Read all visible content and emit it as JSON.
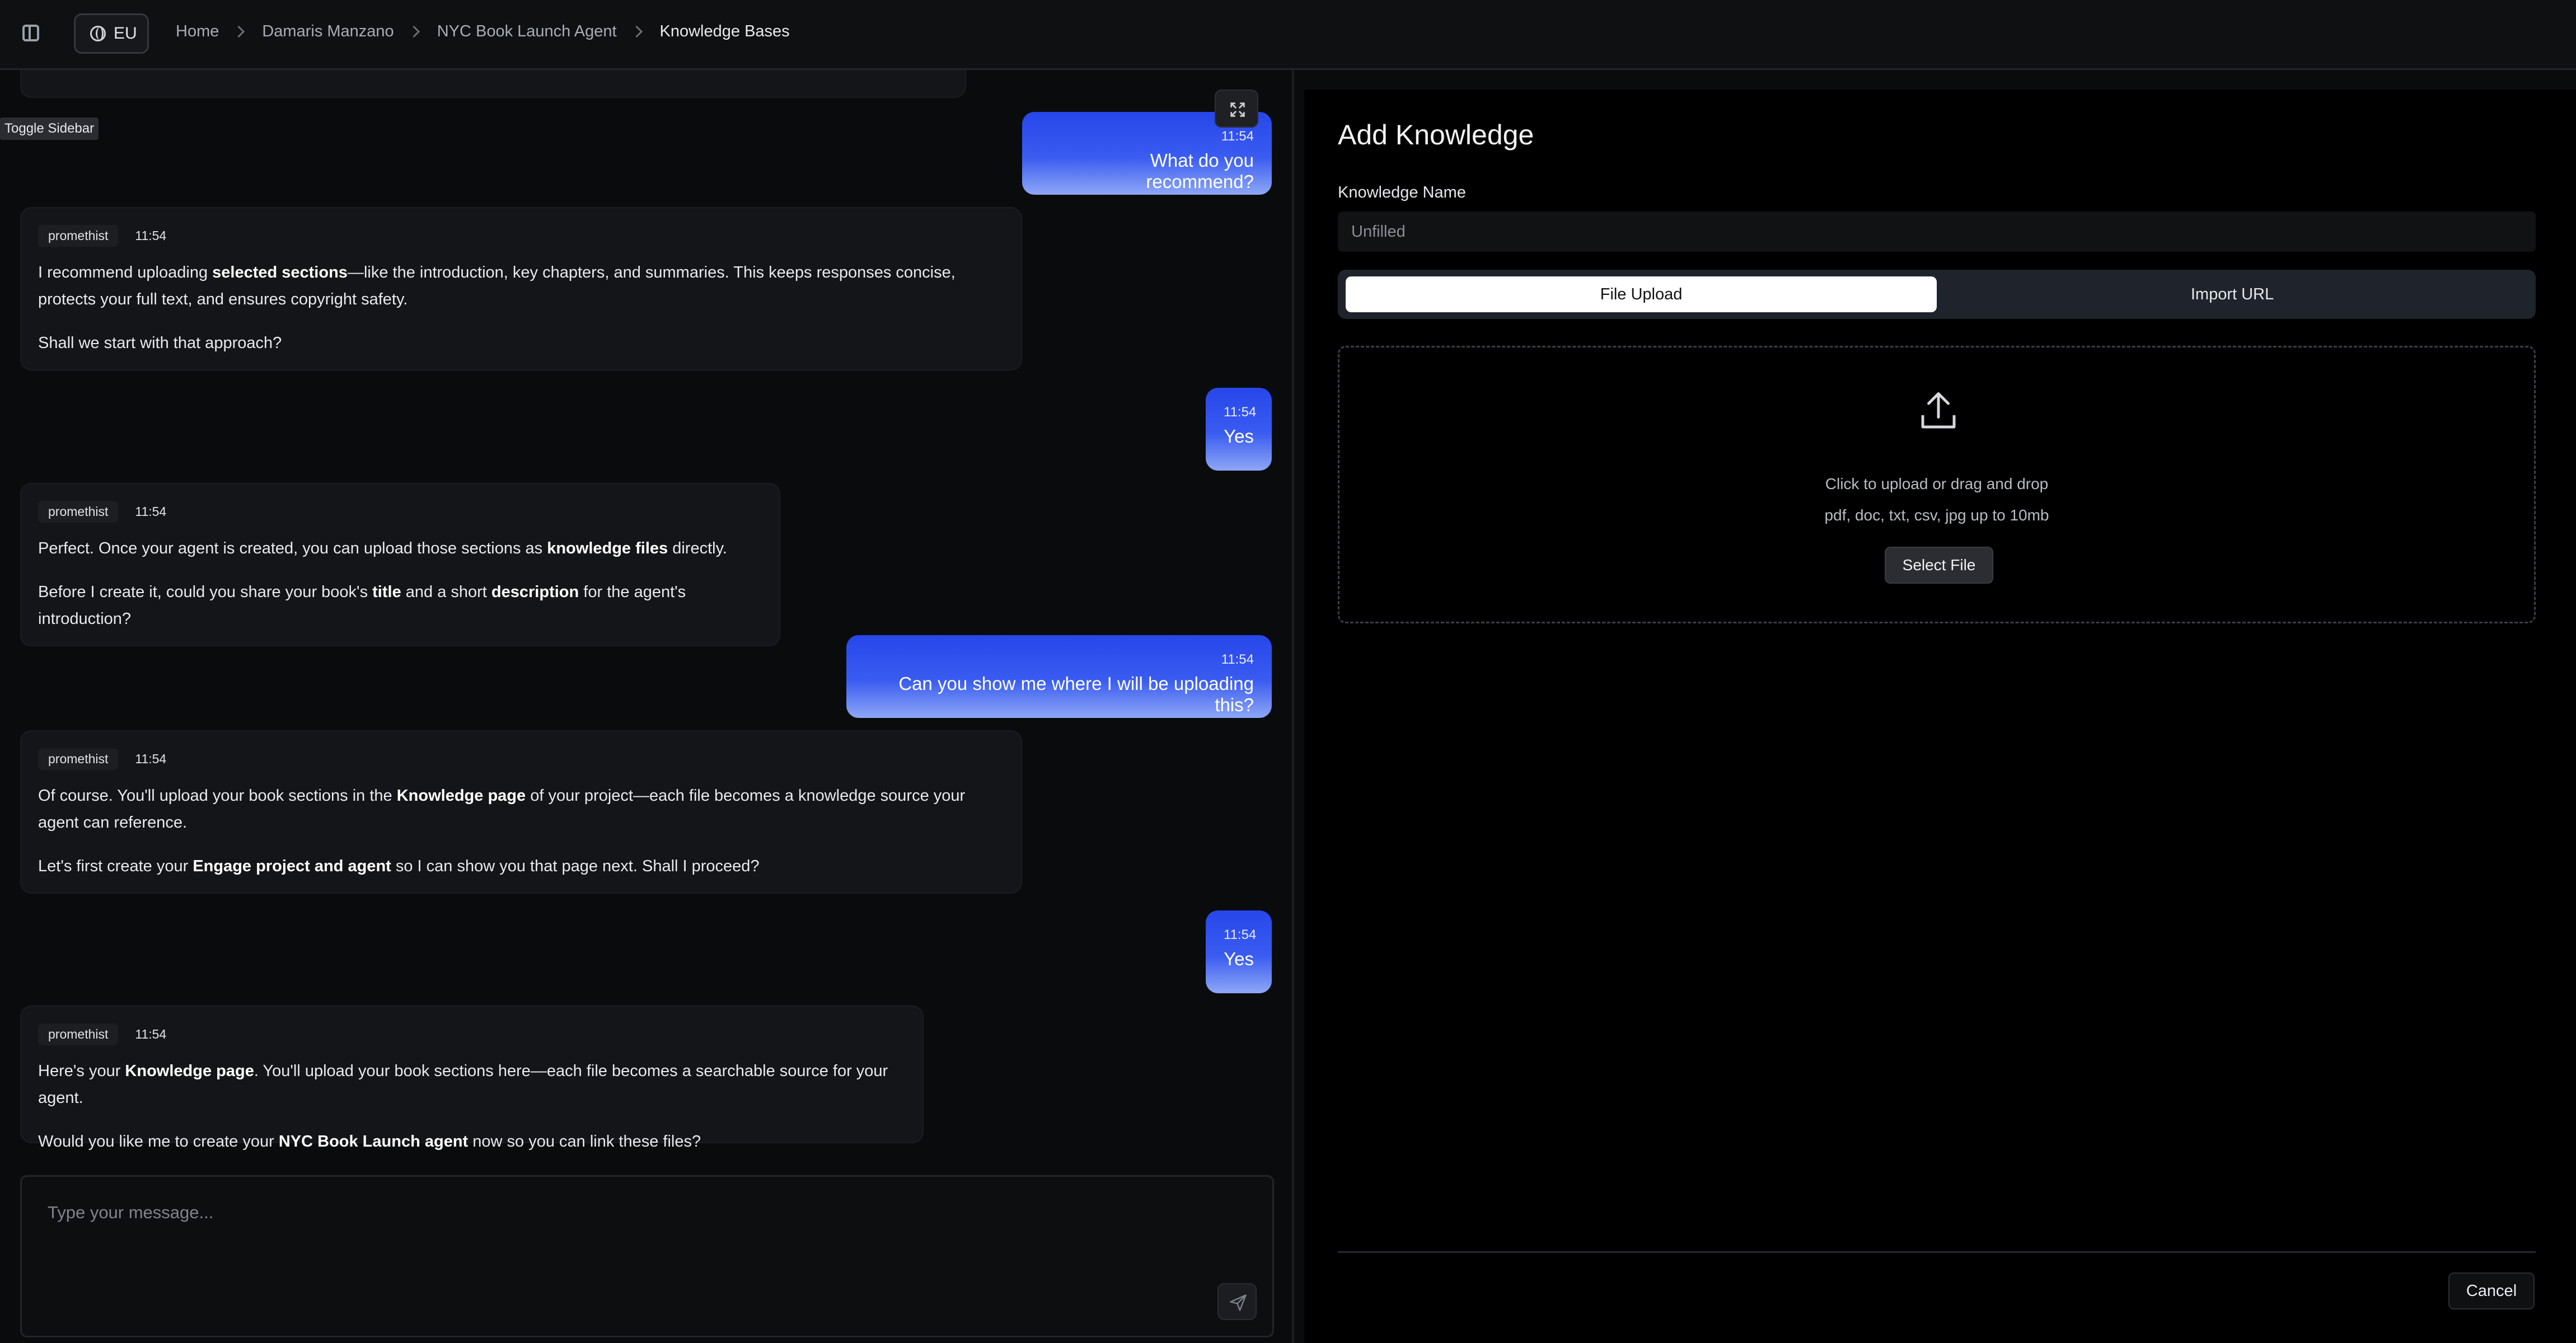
{
  "topbar": {
    "region": "EU",
    "breadcrumb": [
      "Home",
      "Damaris Manzano",
      "NYC Book Launch Agent",
      "Knowledge Bases"
    ]
  },
  "tooltip": "Toggle Sidebar",
  "chat": {
    "messages": [
      {
        "role": "user",
        "time": "11:54",
        "text": "What do you recommend?"
      },
      {
        "role": "bot",
        "name": "promethist",
        "time": "11:54"
      },
      {
        "role": "user",
        "time": "11:54",
        "text": "Yes"
      },
      {
        "role": "bot",
        "name": "promethist",
        "time": "11:54"
      },
      {
        "role": "user",
        "time": "11:54",
        "text": "Can you show me where I will be uploading this?"
      },
      {
        "role": "bot",
        "name": "promethist",
        "time": "11:54"
      },
      {
        "role": "user",
        "time": "11:54",
        "text": "Yes"
      },
      {
        "role": "bot",
        "name": "promethist",
        "time": "11:54"
      }
    ],
    "bot1": {
      "p1_a": "I recommend uploading ",
      "p1_b": "selected sections",
      "p1_c": "—like the introduction, key chapters, and summaries. This keeps responses concise, protects your full text, and ensures copyright safety.",
      "p2": "Shall we start with that approach?"
    },
    "bot2": {
      "p1_a": "Perfect. Once your agent is created, you can upload those sections as ",
      "p1_b": "knowledge files",
      "p1_c": " directly.",
      "p2_a": "Before I create it, could you share your book's ",
      "p2_b": "title",
      "p2_c": " and a short ",
      "p2_d": "description",
      "p2_e": " for the agent's introduction?"
    },
    "bot3": {
      "p1_a": "Of course. You'll upload your book sections in the ",
      "p1_b": "Knowledge page",
      "p1_c": " of your project—each file becomes a knowledge source your agent can reference.",
      "p2_a": "Let's first create your ",
      "p2_b": "Engage project and agent",
      "p2_c": " so I can show you that page next. Shall I proceed?"
    },
    "bot4": {
      "p1_a": "Here's your ",
      "p1_b": "Knowledge page",
      "p1_c": ". You'll upload your book sections here—each file becomes a searchable source for your agent.",
      "p2_a": "Would you like me to create your ",
      "p2_b": "NYC Book Launch agent",
      "p2_c": " now so you can link these files?"
    },
    "composer_placeholder": "Type your message..."
  },
  "panel": {
    "title": "Add Knowledge",
    "name_label": "Knowledge Name",
    "name_placeholder": "Unfilled",
    "tabs": [
      "File Upload",
      "Import URL"
    ],
    "active_tab": "File Upload",
    "dropzone_primary": "Click to upload or drag and drop",
    "dropzone_secondary": "pdf, doc, txt, csv, jpg up to 10mb",
    "select_file": "Select File",
    "cancel": "Cancel"
  },
  "colors": {
    "user_bubble_top": "#2746ea",
    "user_bubble_bottom": "#8ea7f6",
    "background": "#0a0b0d"
  }
}
